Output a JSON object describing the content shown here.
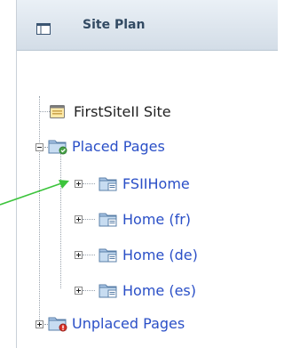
{
  "header": {
    "title": "Site Plan",
    "icon": "site-plan-icon"
  },
  "tree": {
    "root": {
      "label": "FirstSiteII Site",
      "icon": "site-icon"
    },
    "placed": {
      "label": "Placed Pages",
      "icon": "placed-pages-folder-icon",
      "expanded": true
    },
    "pages": [
      {
        "label": "FSIIHome",
        "icon": "page-folder-icon"
      },
      {
        "label": "Home (fr)",
        "icon": "page-folder-icon"
      },
      {
        "label": "Home (de)",
        "icon": "page-folder-icon"
      },
      {
        "label": "Home (es)",
        "icon": "page-folder-icon"
      }
    ],
    "unplaced": {
      "label": "Unplaced Pages",
      "icon": "unplaced-pages-folder-icon",
      "expanded": false
    }
  },
  "colors": {
    "link": "#2a4fc7",
    "pointer": "#3cc43c",
    "header_text": "#324a63"
  }
}
